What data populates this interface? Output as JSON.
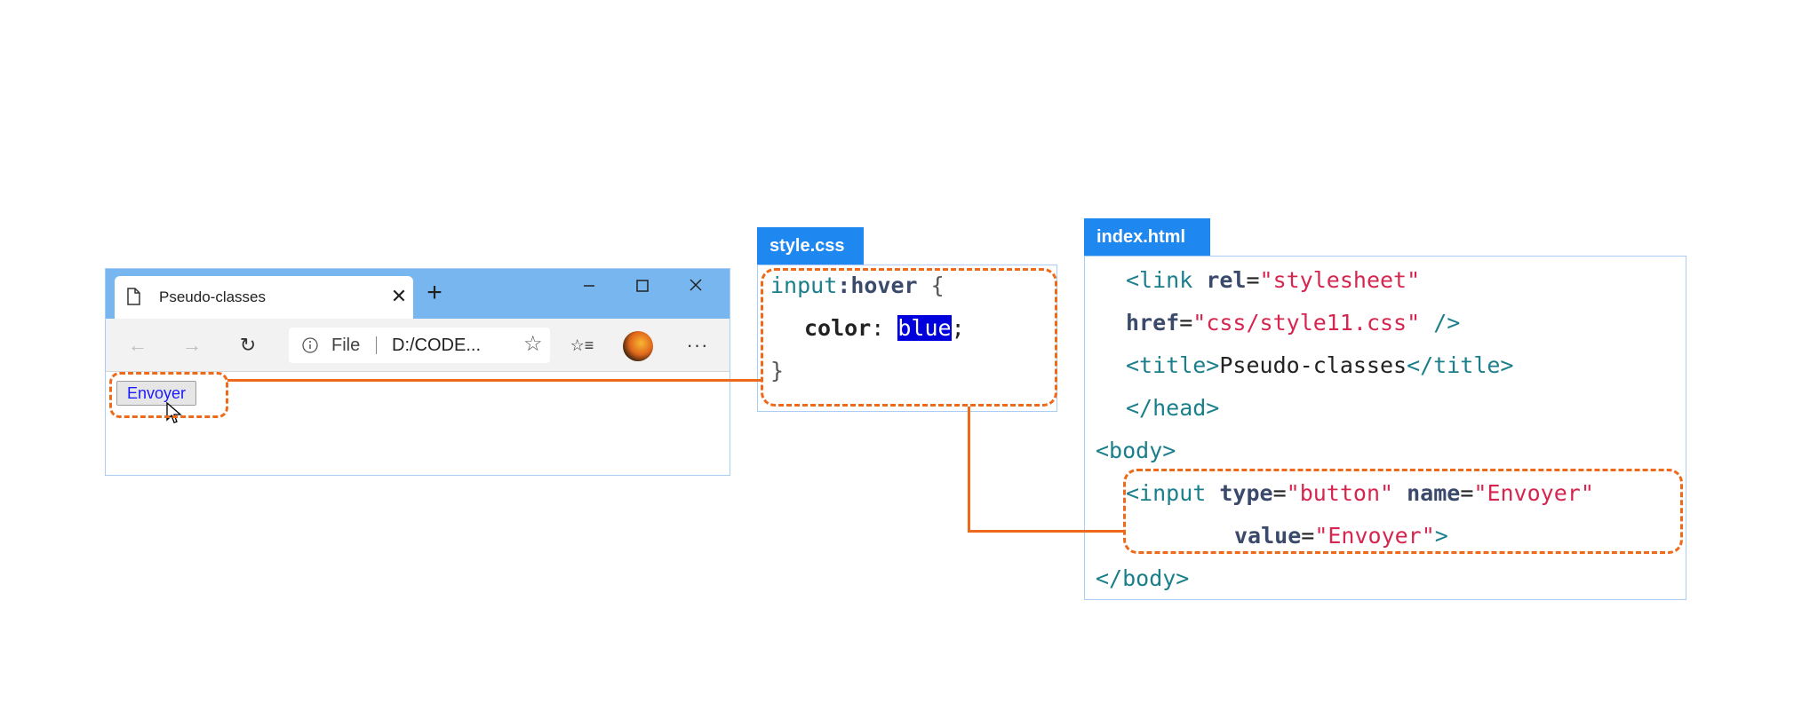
{
  "browser": {
    "tab_title": "Pseudo-classes",
    "tab_close": "✕",
    "new_tab": "+",
    "window_controls": {
      "minimize": "—",
      "maximize": "☐",
      "close": "✕"
    },
    "toolbar": {
      "back": "←",
      "forward": "→",
      "reload": "↻",
      "address_scheme": "File",
      "address_url": "D:/CODE...",
      "favorite_icon": "☆",
      "favorites_icon": "☆≡",
      "more": "···"
    },
    "button_label": "Envoyer"
  },
  "css_panel": {
    "label": "style.css",
    "selector": "input",
    "pseudo": ":hover",
    "open_brace": " {",
    "property": "color",
    "colon": ": ",
    "value": "blue",
    "semicolon": ";",
    "close_brace": "}"
  },
  "html_panel": {
    "label": "index.html",
    "lines": {
      "l1_open": "<link ",
      "l1_rel": "rel",
      "l1_eq": "=",
      "l1_relval": "\"stylesheet\"",
      "l2_href": "href",
      "l2_eq": "=",
      "l2_hrefval": "\"css/style11.css\"",
      "l2_close": " />",
      "l3_open": "<title>",
      "l3_text": "Pseudo-classes",
      "l3_close": "</title>",
      "l4": "</head>",
      "l5": "<body>",
      "l6_open": "<input ",
      "l6_type": "type",
      "l6_eq1": "=",
      "l6_typeval": "\"button\"",
      "l6_sp": " ",
      "l6_name": "name",
      "l6_eq2": "=",
      "l6_nameval": "\"Envoyer\"",
      "l7_value": "value",
      "l7_eq": "=",
      "l7_valueval": "\"Envoyer\"",
      "l7_close": ">",
      "l8": "</body>"
    }
  },
  "colors": {
    "highlight_dash": "#ee6a1a",
    "tab_label_bg": "#1f87f0",
    "hover_blue": "#0000dd"
  }
}
